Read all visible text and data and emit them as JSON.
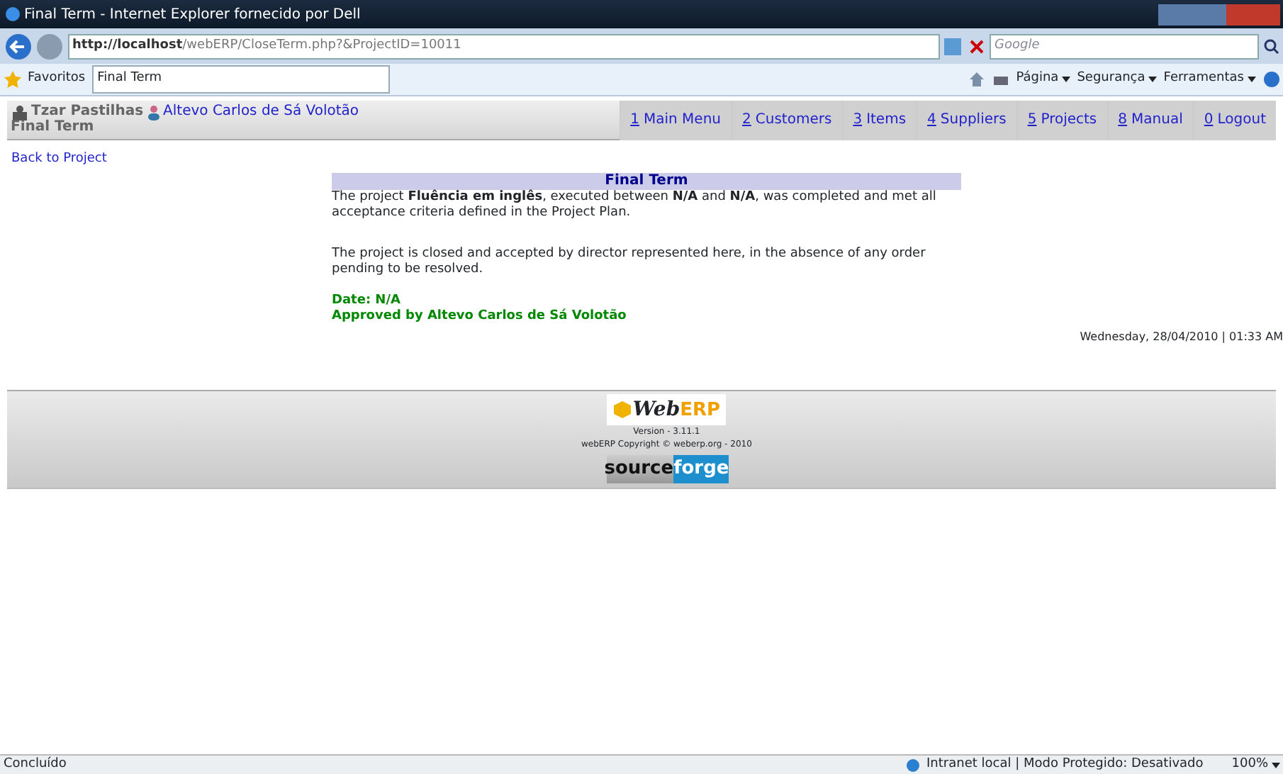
{
  "window": {
    "title": "Final Term - Internet Explorer fornecido por Dell"
  },
  "address_bar": {
    "url_host": "http://localhost",
    "url_path": "/webERP/CloseTerm.php?&ProjectID=10011",
    "search_placeholder": "Google"
  },
  "favorites_bar": {
    "favorites": "Favoritos",
    "tab": "Final Term",
    "commands": [
      "Página",
      "Segurança",
      "Ferramentas"
    ]
  },
  "header": {
    "company": "Tzar Pastilhas",
    "user": "Altevo Carlos de Sá Volotão",
    "page_title": "Final Term",
    "menu": [
      {
        "key": "1",
        "label": "Main Menu"
      },
      {
        "key": "2",
        "label": "Customers"
      },
      {
        "key": "3",
        "label": "Items"
      },
      {
        "key": "4",
        "label": "Suppliers"
      },
      {
        "key": "5",
        "label": "Projects"
      },
      {
        "key": "8",
        "label": "Manual"
      },
      {
        "key": "0",
        "label": "Logout"
      }
    ]
  },
  "back_link": "Back to Project",
  "term": {
    "heading": "Final Term",
    "paragraphs": [
      "The project **Fluência em inglês**, executed between **N/A** and **N/A**, was completed and met all acceptance criteria defined in the Project Plan.",
      "The project is closed and accepted by director represented here, in the absence of any order pending to be resolved."
    ],
    "date": "Date: N/A",
    "approved": "Approved by Altevo Carlos de Sá Volotão"
  },
  "datetime": "Wednesday, 28/04/2010 | 01:33 AM",
  "footer": {
    "logo_a": "Web",
    "logo_b": "ERP",
    "version": "Version - 3.11.1",
    "copyright": "webERP Copyright © weberp.org - 2010",
    "sf_a": "source",
    "sf_b": "forge"
  },
  "status_bar": {
    "text": "Concluído",
    "zone": "Intranet local | Modo Protegido: Desativado",
    "zoom": "100%"
  }
}
